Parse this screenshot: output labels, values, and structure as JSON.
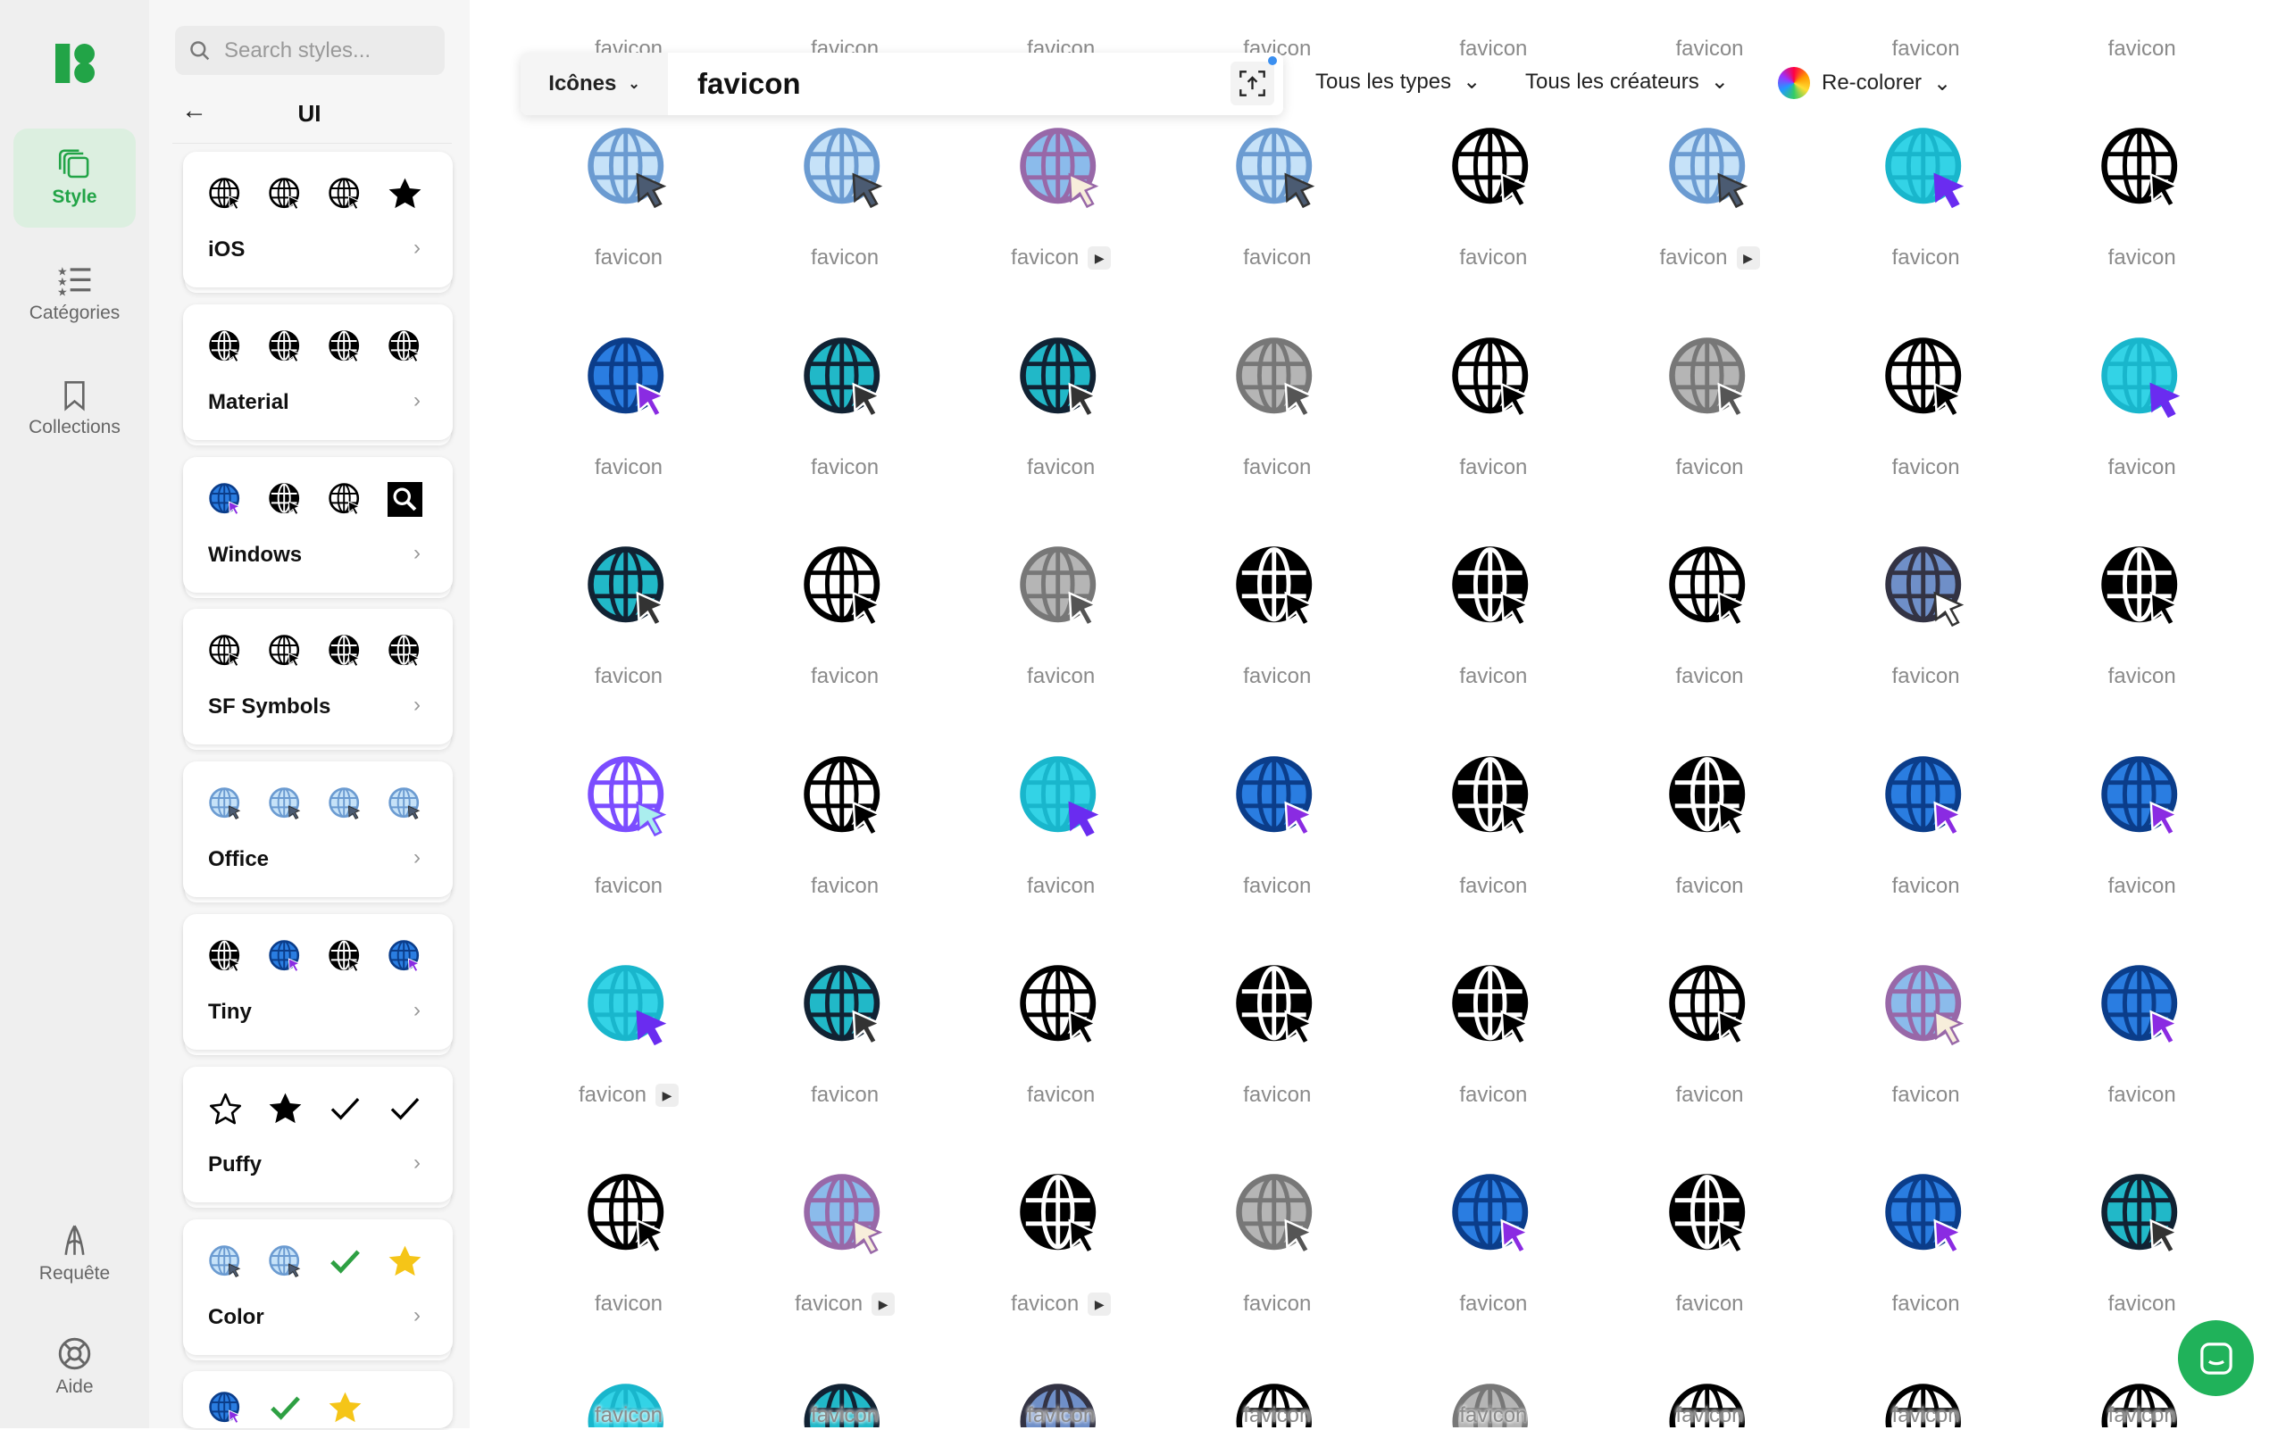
{
  "rail": {
    "items": [
      {
        "label": "Style",
        "icon": "stack-icon",
        "active": true
      },
      {
        "label": "Catégories",
        "icon": "star-list-icon"
      },
      {
        "label": "Collections",
        "icon": "bookmark-icon"
      },
      {
        "label": "Requête",
        "icon": "request-icon"
      },
      {
        "label": "Aide",
        "icon": "lifebuoy-icon"
      }
    ],
    "brand_color": "#22a447"
  },
  "panel": {
    "search_placeholder": "Search styles...",
    "title": "UI",
    "styles": [
      {
        "name": "iOS",
        "icons": [
          "black",
          "black",
          "black",
          "star-black"
        ]
      },
      {
        "name": "Material",
        "icons": [
          "black-solid",
          "black-solid",
          "black-solid",
          "black-solid"
        ]
      },
      {
        "name": "Windows",
        "icons": [
          "blue",
          "black-solid",
          "black",
          "search-black"
        ]
      },
      {
        "name": "SF Symbols",
        "icons": [
          "black",
          "black",
          "black-solid",
          "black-solid"
        ]
      },
      {
        "name": "Office",
        "icons": [
          "lightblue",
          "lightblue",
          "lightblue",
          "lightblue"
        ]
      },
      {
        "name": "Tiny",
        "icons": [
          "black-solid",
          "blue",
          "black-solid",
          "blue"
        ]
      },
      {
        "name": "Puffy",
        "icons": [
          "star-outline",
          "star-black",
          "check",
          "check"
        ]
      },
      {
        "name": "Color",
        "icons": [
          "lightblue",
          "lightblue",
          "check-green",
          "star-yellow"
        ]
      },
      {
        "name": "",
        "icons": [
          "blue",
          "check-green",
          "star-yellow"
        ]
      }
    ]
  },
  "search": {
    "type": "Icônes",
    "query": "favicon"
  },
  "filters": {
    "types": "Tous les types",
    "creators": "Tous les créateurs",
    "recolor": "Re-colorer"
  },
  "grid": {
    "rows": [
      [
        {
          "label": "favicon",
          "style": "black"
        },
        {
          "label": "favicon",
          "style": "blue"
        },
        {
          "label": "favicon",
          "style": "purple"
        },
        {
          "label": "favicon",
          "style": "black"
        },
        {
          "label": "favicon",
          "style": "black"
        },
        {
          "label": "favicon",
          "style": "black"
        },
        {
          "label": "favicon",
          "style": "black"
        },
        {
          "label": "favicon",
          "style": "black"
        }
      ],
      [
        {
          "label": "favicon",
          "style": "lightblue"
        },
        {
          "label": "favicon",
          "style": "lightblue"
        },
        {
          "label": "favicon",
          "style": "purple",
          "video": true
        },
        {
          "label": "favicon",
          "style": "lightblue"
        },
        {
          "label": "favicon",
          "style": "black"
        },
        {
          "label": "favicon",
          "style": "lightblue",
          "video": true
        },
        {
          "label": "favicon",
          "style": "cyan"
        },
        {
          "label": "favicon",
          "style": "black"
        }
      ],
      [
        {
          "label": "favicon",
          "style": "blue"
        },
        {
          "label": "favicon",
          "style": "teal"
        },
        {
          "label": "favicon",
          "style": "teal"
        },
        {
          "label": "favicon",
          "style": "gray"
        },
        {
          "label": "favicon",
          "style": "black"
        },
        {
          "label": "favicon",
          "style": "gray"
        },
        {
          "label": "favicon",
          "style": "black"
        },
        {
          "label": "favicon",
          "style": "cyan"
        }
      ],
      [
        {
          "label": "favicon",
          "style": "teal"
        },
        {
          "label": "favicon",
          "style": "black"
        },
        {
          "label": "favicon",
          "style": "gray"
        },
        {
          "label": "favicon",
          "style": "black-solid"
        },
        {
          "label": "favicon",
          "style": "black-solid"
        },
        {
          "label": "favicon",
          "style": "black"
        },
        {
          "label": "favicon",
          "style": "slate"
        },
        {
          "label": "favicon",
          "style": "black-solid"
        }
      ],
      [
        {
          "label": "favicon",
          "style": "violet"
        },
        {
          "label": "favicon",
          "style": "black"
        },
        {
          "label": "favicon",
          "style": "cyan"
        },
        {
          "label": "favicon",
          "style": "blue"
        },
        {
          "label": "favicon",
          "style": "black-solid"
        },
        {
          "label": "favicon",
          "style": "black-solid"
        },
        {
          "label": "favicon",
          "style": "blue"
        },
        {
          "label": "favicon",
          "style": "blue"
        }
      ],
      [
        {
          "label": "favicon",
          "style": "cyan",
          "video": true
        },
        {
          "label": "favicon",
          "style": "teal"
        },
        {
          "label": "favicon",
          "style": "black"
        },
        {
          "label": "favicon",
          "style": "black-solid"
        },
        {
          "label": "favicon",
          "style": "black-solid"
        },
        {
          "label": "favicon",
          "style": "black"
        },
        {
          "label": "favicon",
          "style": "purple"
        },
        {
          "label": "favicon",
          "style": "blue"
        }
      ],
      [
        {
          "label": "favicon",
          "style": "black"
        },
        {
          "label": "favicon",
          "style": "purple",
          "video": true
        },
        {
          "label": "favicon",
          "style": "black-solid",
          "video": true
        },
        {
          "label": "favicon",
          "style": "gray"
        },
        {
          "label": "favicon",
          "style": "blue"
        },
        {
          "label": "favicon",
          "style": "black-solid"
        },
        {
          "label": "favicon",
          "style": "blue"
        },
        {
          "label": "favicon",
          "style": "teal"
        }
      ],
      [
        {
          "label": "favicon",
          "style": "cyan"
        },
        {
          "label": "favicon",
          "style": "teal"
        },
        {
          "label": "favicon",
          "style": "slate"
        },
        {
          "label": "favicon",
          "style": "black"
        },
        {
          "label": "favicon",
          "style": "gray"
        },
        {
          "label": "favicon",
          "style": "black"
        },
        {
          "label": "favicon",
          "style": "black"
        },
        {
          "label": "favicon",
          "style": "black"
        }
      ]
    ]
  },
  "colors": {
    "accent": "#22a447",
    "chat": "#20b25a",
    "label": "#8a8a8a"
  }
}
